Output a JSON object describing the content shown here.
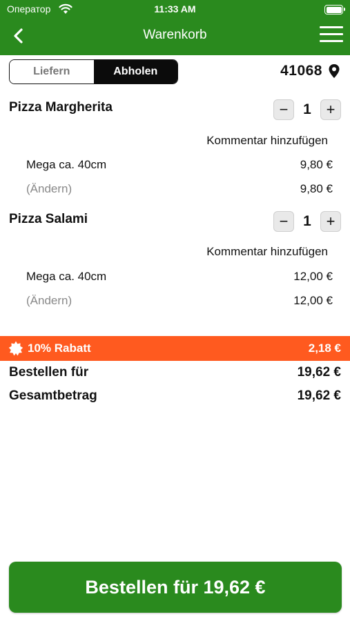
{
  "status_bar": {
    "carrier": "Оператор",
    "time": "11:33 AM",
    "battery_level": 1.0
  },
  "nav": {
    "title": "Warenkorb"
  },
  "mode_switch": {
    "options": [
      "Liefern",
      "Abholen"
    ],
    "selected": "Abholen"
  },
  "location": {
    "zip": "41068"
  },
  "items": [
    {
      "name": "Pizza Margherita",
      "qty": "1",
      "comment_link": "Kommentar hinzufügen",
      "size_label": "Mega ca. 40cm",
      "size_price": "9,80 €",
      "edit_label": "(Ändern)",
      "total_price": "9,80 €"
    },
    {
      "name": "Pizza Salami",
      "qty": "1",
      "comment_link": "Kommentar hinzufügen",
      "size_label": "Mega ca. 40cm",
      "size_price": "12,00 €",
      "edit_label": "(Ändern)",
      "total_price": "12,00 €"
    }
  ],
  "discount": {
    "label": "10% Rabatt",
    "amount": "2,18 €",
    "color": "#ff5a1f"
  },
  "summary": {
    "order_for_label": "Bestellen für",
    "order_for_value": "19,62 €",
    "total_label": "Gesamtbetrag",
    "total_value": "19,62 €"
  },
  "order_button": {
    "label": "Bestellen für 19,62 €"
  },
  "colors": {
    "brand_green": "#2a8a1e",
    "discount_orange": "#ff5a1f",
    "segment_active": "#0b0b0b"
  },
  "icons": [
    "wifi-icon",
    "battery-icon",
    "back-chevron-icon",
    "hamburger-menu-icon",
    "location-pin-icon",
    "minus-icon",
    "plus-icon",
    "discount-badge-icon"
  ]
}
